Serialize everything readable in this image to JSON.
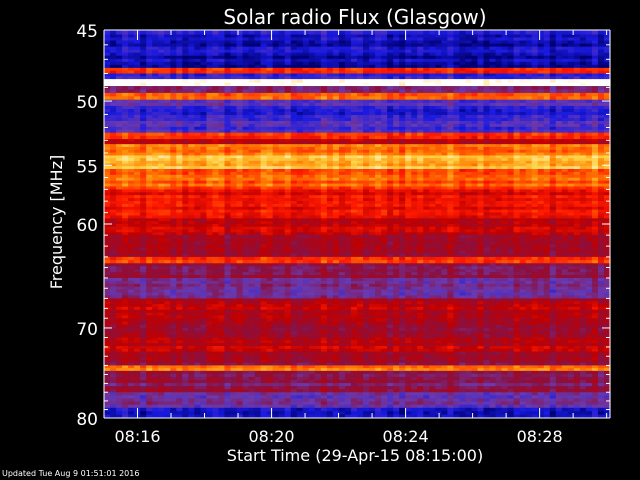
{
  "footer": {
    "updated": "Updated Tue Aug  9 01:51:01 2016"
  },
  "chart_data": {
    "type": "heatmap",
    "title": "Solar radio Flux (Glasgow)",
    "xlabel": "Start Time (29-Apr-15 08:15:00)",
    "ylabel": "Frequency [MHz]",
    "x_ticks": [
      "08:16",
      "08:20",
      "08:24",
      "08:28"
    ],
    "x_tick_minutes": [
      16,
      20,
      24,
      28
    ],
    "xlim_minutes": [
      15,
      30.1
    ],
    "y_ticks": [
      45,
      50,
      55,
      60,
      70,
      80
    ],
    "ylim": [
      45,
      80
    ],
    "y_scale": "log",
    "grid": false,
    "legend": "none",
    "colormap": [
      "#000070",
      "#1a1ae0",
      "#6a3ab0",
      "#8a1040",
      "#c00000",
      "#ff1a00",
      "#ff7a00",
      "#ffd040",
      "#ffffff"
    ],
    "bands": [
      {
        "f": [
          45.0,
          45.3
        ],
        "level": 0.1
      },
      {
        "f": [
          45.3,
          47.6
        ],
        "level": 0.08
      },
      {
        "f": [
          47.6,
          48.0
        ],
        "level": 0.65
      },
      {
        "f": [
          48.0,
          48.4
        ],
        "level": 0.18
      },
      {
        "f": [
          48.4,
          48.9
        ],
        "level": 1.0
      },
      {
        "f": [
          48.9,
          49.4
        ],
        "level": 0.3
      },
      {
        "f": [
          49.4,
          49.9
        ],
        "level": 0.7
      },
      {
        "f": [
          49.9,
          50.6
        ],
        "level": 0.2
      },
      {
        "f": [
          50.6,
          51.5
        ],
        "level": 0.12
      },
      {
        "f": [
          51.5,
          52.4
        ],
        "level": 0.2
      },
      {
        "f": [
          52.4,
          52.9
        ],
        "level": 0.62
      },
      {
        "f": [
          52.9,
          53.3
        ],
        "level": 0.5
      },
      {
        "f": [
          53.3,
          54.2
        ],
        "level": 0.75
      },
      {
        "f": [
          54.2,
          55.3
        ],
        "level": 0.85
      },
      {
        "f": [
          55.3,
          57.0
        ],
        "level": 0.7
      },
      {
        "f": [
          57.0,
          59.5
        ],
        "level": 0.58
      },
      {
        "f": [
          59.5,
          61.0
        ],
        "level": 0.52
      },
      {
        "f": [
          61.0,
          63.0
        ],
        "level": 0.45
      },
      {
        "f": [
          63.0,
          63.6
        ],
        "level": 0.7
      },
      {
        "f": [
          63.6,
          65.0
        ],
        "level": 0.35
      },
      {
        "f": [
          65.0,
          67.0
        ],
        "level": 0.3
      },
      {
        "f": [
          67.0,
          69.0
        ],
        "level": 0.48
      },
      {
        "f": [
          69.0,
          71.0
        ],
        "level": 0.42
      },
      {
        "f": [
          71.0,
          72.5
        ],
        "level": 0.5
      },
      {
        "f": [
          72.5,
          74.0
        ],
        "level": 0.42
      },
      {
        "f": [
          74.0,
          74.6
        ],
        "level": 0.72
      },
      {
        "f": [
          74.6,
          77.0
        ],
        "level": 0.36
      },
      {
        "f": [
          77.0,
          78.8
        ],
        "level": 0.26
      },
      {
        "f": [
          78.8,
          80.0
        ],
        "level": 0.12
      }
    ]
  }
}
